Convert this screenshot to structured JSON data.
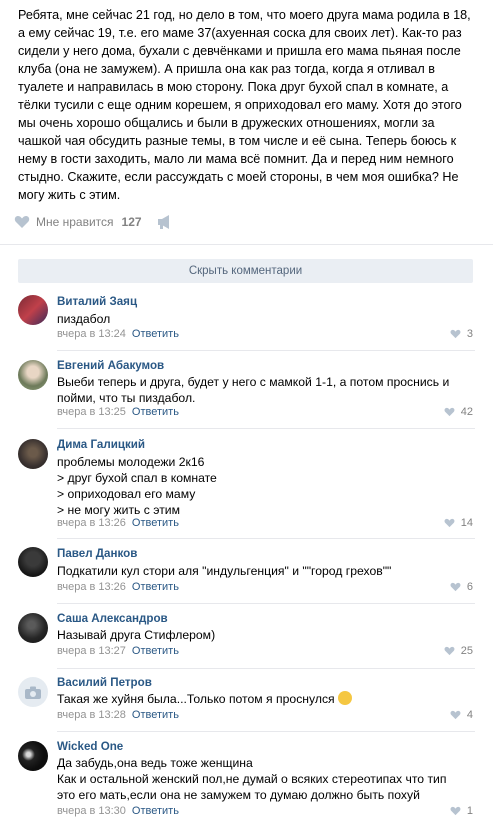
{
  "post": {
    "text": "Ребята, мне сейчас 21 год, но дело в том, что моего друга мама родила в 18, а ему сейчас 19, т.е. его маме 37(ахуенная соска для своих лет). Как-то раз сидели у него дома, бухали с девчёнками и пришла его мама пьяная после клуба (она не замужем). А пришла она как раз тогда, когда я отливал в туалете и направилась в мою сторону. Пока друг бухой спал в комнате, а тёлки тусили с еще одним корешем, я оприходовал его маму. Хотя до этого мы очень хорошо общались и были в дружеских отношениях, могли за чашкой чая обсудить разные темы, в том числе и её сына. Теперь боюсь к нему в гости заходить, мало ли мама всё помнит. Да и перед ним немного стыдно. Скажите, если рассуждать с моей стороны, в чем моя ошибка? Не могу жить с этим.",
    "like_label": "Мне нравится",
    "like_count": "127"
  },
  "hide_comments_label": "Скрыть комментарии",
  "comments": [
    {
      "author": "Виталий Заяц",
      "lines": [
        "пиздабол"
      ],
      "date": "вчера в 13:24",
      "reply": "Ответить",
      "likes": "3"
    },
    {
      "author": "Евгений Абакумов",
      "lines": [
        "Выеби теперь и друга, будет у него с мамкой 1-1, а потом проснись и",
        "пойми, что ты пиздабол."
      ],
      "date": "вчера в 13:25",
      "reply": "Ответить",
      "likes": "42"
    },
    {
      "author": "Дима Галицкий",
      "lines": [
        "проблемы молодежи 2к16",
        "> друг бухой спал в комнате",
        "> оприходовал его маму",
        "> не могу жить с этим"
      ],
      "date": "вчера в 13:26",
      "reply": "Ответить",
      "likes": "14"
    },
    {
      "author": "Павел Данков",
      "lines": [
        "Подкатили кул стори аля \"индульгенция\" и \"\"город грехов\"\""
      ],
      "date": "вчера в 13:26",
      "reply": "Ответить",
      "likes": "6"
    },
    {
      "author": "Саша Александров",
      "lines": [
        "Называй друга Стифлером)"
      ],
      "date": "вчера в 13:27",
      "reply": "Ответить",
      "likes": "25"
    },
    {
      "author": "Василий Петров",
      "lines": [
        "Такая же хуйня была...Только потом я проснулся"
      ],
      "date": "вчера в 13:28",
      "reply": "Ответить",
      "likes": "4"
    },
    {
      "author": "Wicked One",
      "lines": [
        "Да забудь,она ведь тоже женщина",
        "Как и остальной женский пол,не думай о всяких стереотипах что тип",
        "это его мать,если она не замужем то думаю должно быть похуй"
      ],
      "date": "вчера в 13:30",
      "reply": "Ответить",
      "likes": "1"
    }
  ],
  "colors": {
    "link": "#2a5885",
    "meta": "#939393",
    "button_bg": "#eaeef3"
  }
}
